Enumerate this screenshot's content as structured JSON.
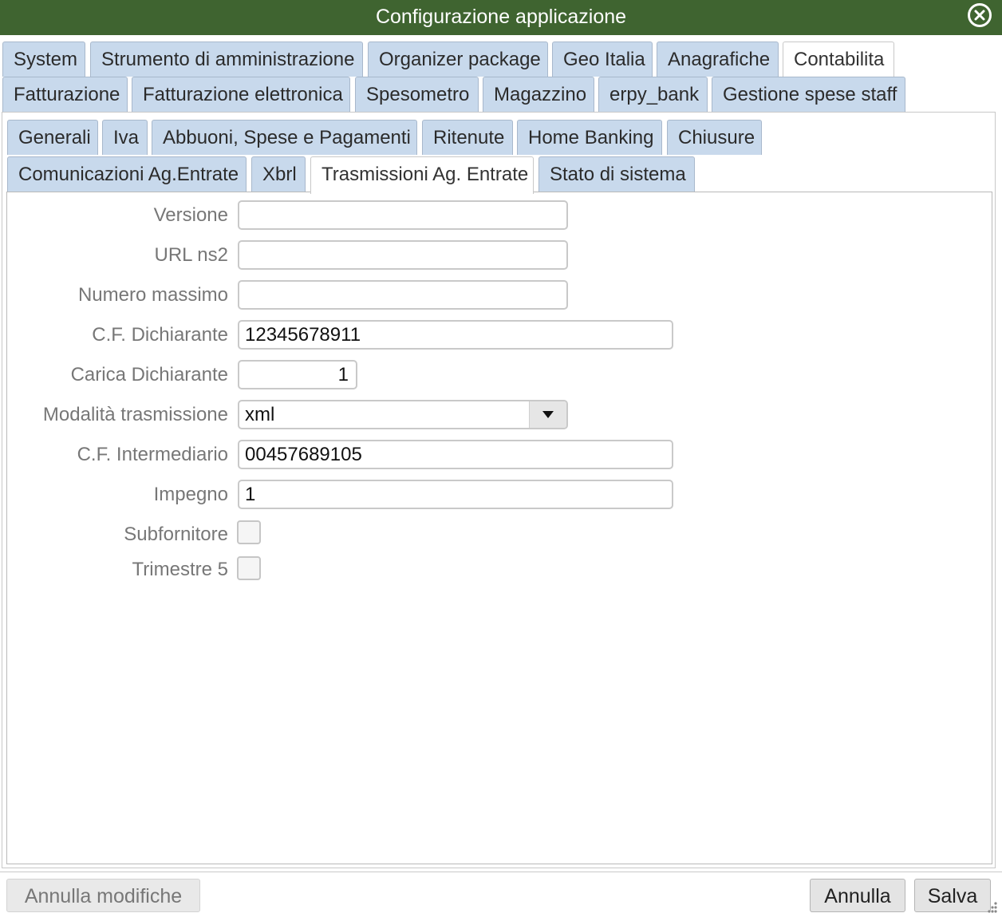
{
  "window": {
    "title": "Configurazione applicazione",
    "close_icon": "close-circle-icon",
    "title_bar_color": "#3f6430"
  },
  "main_tabs": [
    {
      "label": "System",
      "active": false
    },
    {
      "label": "Strumento di amministrazione",
      "active": false
    },
    {
      "label": "Organizer package",
      "active": false
    },
    {
      "label": "Geo Italia",
      "active": false
    },
    {
      "label": "Anagrafiche",
      "active": false
    },
    {
      "label": "Contabilita",
      "active": true
    },
    {
      "label": "Fatturazione",
      "active": false
    },
    {
      "label": "Fatturazione elettronica",
      "active": false
    },
    {
      "label": "Spesometro",
      "active": false
    },
    {
      "label": "Magazzino",
      "active": false
    },
    {
      "label": "erpy_bank",
      "active": false
    },
    {
      "label": "Gestione spese staff",
      "active": false
    }
  ],
  "sub_tabs": [
    {
      "label": "Generali",
      "active": false
    },
    {
      "label": "Iva",
      "active": false
    },
    {
      "label": "Abbuoni, Spese e Pagamenti",
      "active": false
    },
    {
      "label": "Ritenute",
      "active": false
    },
    {
      "label": "Home Banking",
      "active": false
    },
    {
      "label": "Chiusure",
      "active": false
    },
    {
      "label": "Comunicazioni Ag.Entrate",
      "active": false
    },
    {
      "label": "Xbrl",
      "active": false
    },
    {
      "label": "Trasmissioni Ag. Entrate",
      "active": true
    },
    {
      "label": "Stato di sistema",
      "active": false
    }
  ],
  "form": {
    "versione": {
      "label": "Versione",
      "value": ""
    },
    "url_ns2": {
      "label": "URL ns2",
      "value": ""
    },
    "numero_massimo": {
      "label": "Numero massimo",
      "value": ""
    },
    "cf_dichiarante": {
      "label": "C.F. Dichiarante",
      "value": "12345678911"
    },
    "carica_dichiarante": {
      "label": "Carica Dichiarante",
      "value": "1"
    },
    "modalita_trasmissione": {
      "label": "Modalità trasmissione",
      "value": "xml",
      "icon": "dropdown-arrow-icon"
    },
    "cf_intermediario": {
      "label": "C.F. Intermediario",
      "value": "00457689105"
    },
    "impegno": {
      "label": "Impegno",
      "value": "1"
    },
    "subfornitore": {
      "label": "Subfornitore",
      "checked": false
    },
    "trimestre_5": {
      "label": "Trimestre 5",
      "checked": false
    }
  },
  "footer": {
    "annulla_modifiche": "Annulla modifiche",
    "annulla": "Annulla",
    "salva": "Salva",
    "resize_icon": "resize-grip-icon"
  },
  "colors": {
    "tab_inactive": "#c8d9ec",
    "tab_active": "#ffffff",
    "label_text": "#777777"
  }
}
